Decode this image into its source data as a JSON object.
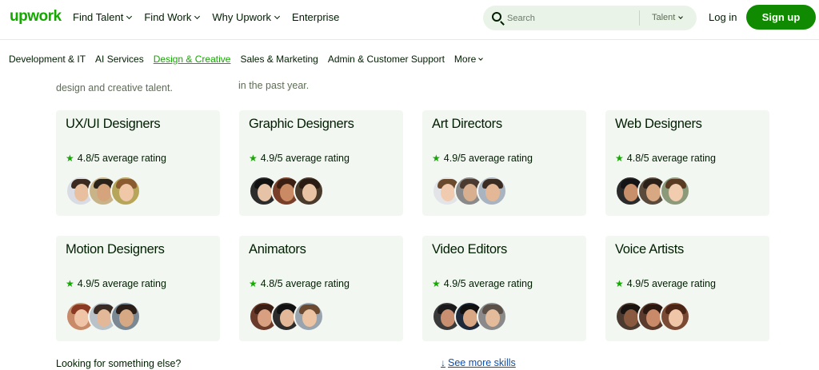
{
  "header": {
    "logo": "upwork",
    "nav": [
      {
        "label": "Find Talent",
        "dropdown": true
      },
      {
        "label": "Find Work",
        "dropdown": true
      },
      {
        "label": "Why Upwork",
        "dropdown": true
      },
      {
        "label": "Enterprise",
        "dropdown": false
      }
    ],
    "search": {
      "placeholder": "Search",
      "value": "",
      "scope": "Talent"
    },
    "login_label": "Log in",
    "signup_label": "Sign up"
  },
  "categories": [
    {
      "label": "Development & IT",
      "active": false
    },
    {
      "label": "AI Services",
      "active": false
    },
    {
      "label": "Design & Creative",
      "active": true
    },
    {
      "label": "Sales & Marketing",
      "active": false
    },
    {
      "label": "Admin & Customer Support",
      "active": false
    },
    {
      "label": "More",
      "active": false
    }
  ],
  "intro": {
    "left_fragment": "design and creative talent.",
    "right_fragment": "in the past year."
  },
  "cards": [
    {
      "title": "UX/UI Designers",
      "rating": "4.8/5 average rating"
    },
    {
      "title": "Graphic Designers",
      "rating": "4.9/5 average rating"
    },
    {
      "title": "Art Directors",
      "rating": "4.9/5 average rating"
    },
    {
      "title": "Web Designers",
      "rating": "4.8/5 average rating"
    },
    {
      "title": "Motion Designers",
      "rating": "4.9/5 average rating"
    },
    {
      "title": "Animators",
      "rating": "4.8/5 average rating"
    },
    {
      "title": "Video Editors",
      "rating": "4.9/5 average rating"
    },
    {
      "title": "Voice Artists",
      "rating": "4.9/5 average rating"
    }
  ],
  "footer": {
    "looking_text": "Looking for something else?",
    "see_more_label": "See more skills"
  },
  "colors": {
    "brand": "#14a800",
    "signup_bg": "#108a00",
    "card_bg": "#f2f7f2",
    "search_bg": "#eaf3e8",
    "link": "#0f4fa8"
  },
  "icons": {
    "search": "search-icon",
    "star": "star-icon",
    "chevron": "chevron-down-icon",
    "arrow": "arrow-down-icon"
  }
}
